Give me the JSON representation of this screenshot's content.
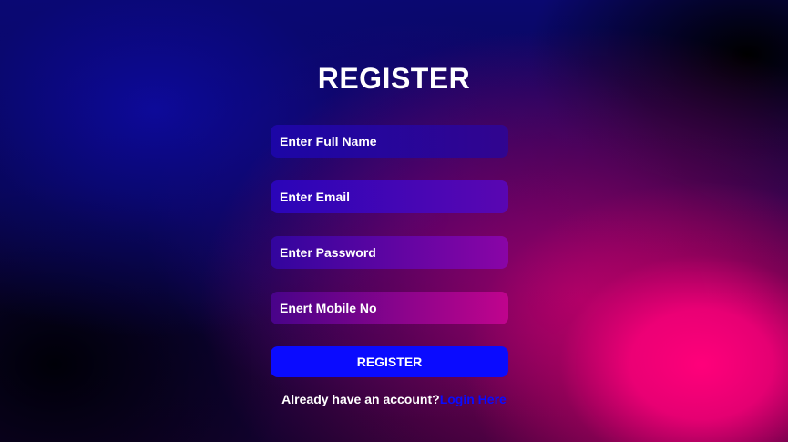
{
  "form": {
    "title": "REGISTER",
    "fields": [
      {
        "placeholder": "Enter  Full Name"
      },
      {
        "placeholder": "Enter Email"
      },
      {
        "placeholder": "Enter Password"
      },
      {
        "placeholder": "Enert Mobile No"
      }
    ],
    "submit_label": "REGISTER",
    "footer_text": "Already have an account?",
    "login_link": "Login Here"
  },
  "colors": {
    "button": "#0a0bff",
    "link": "#0a0bff",
    "text": "#ffffff"
  }
}
